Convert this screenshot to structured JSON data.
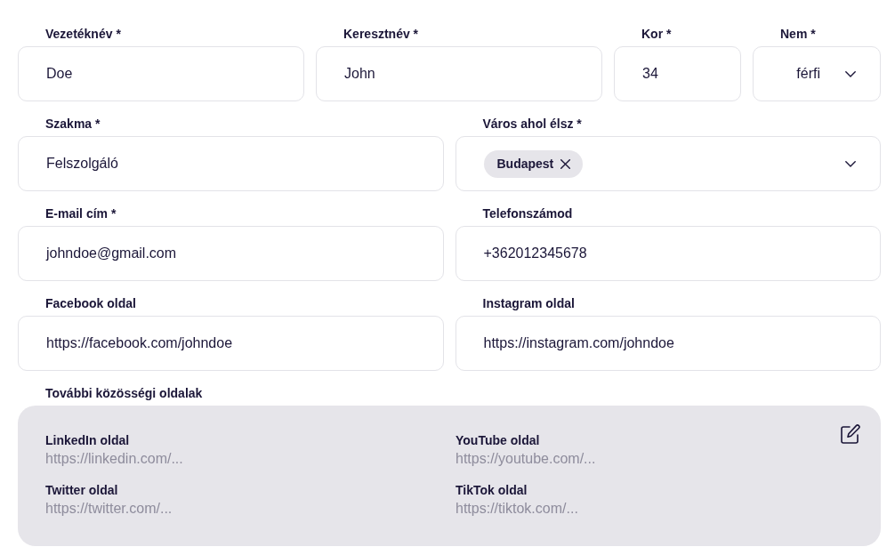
{
  "rows": [
    [
      {
        "kind": "text",
        "label": "Vezetéknév *",
        "value": "Doe"
      },
      {
        "kind": "text",
        "label": "Keresztnév *",
        "value": "John"
      },
      {
        "kind": "text",
        "label": "Kor *",
        "value": "34"
      },
      {
        "kind": "select",
        "label": "Nem *",
        "value": "férfi"
      }
    ],
    [
      {
        "kind": "text",
        "label": "Szakma *",
        "value": "Felszolgáló"
      },
      {
        "kind": "tags",
        "label": "Város ahol élsz *",
        "tags": [
          "Budapest"
        ]
      }
    ],
    [
      {
        "kind": "text",
        "label": "E-mail cím *",
        "value": "johndoe@gmail.com"
      },
      {
        "kind": "text",
        "label": "Telefonszámod",
        "value": "+362012345678"
      }
    ],
    [
      {
        "kind": "text",
        "label": "Facebook oldal",
        "value": "https://facebook.com/johndoe"
      },
      {
        "kind": "text",
        "label": "Instagram oldal",
        "value": "https://instagram.com/johndoe"
      }
    ]
  ],
  "social": {
    "label": "További közösségi oldalak",
    "items": [
      {
        "label": "LinkedIn oldal",
        "url": "https://linkedin.com/..."
      },
      {
        "label": "YouTube oldal",
        "url": "https://youtube.com/..."
      },
      {
        "label": "Twitter oldal",
        "url": "https://twitter.com/..."
      },
      {
        "label": "TikTok oldal",
        "url": "https://tiktok.com/..."
      }
    ]
  }
}
